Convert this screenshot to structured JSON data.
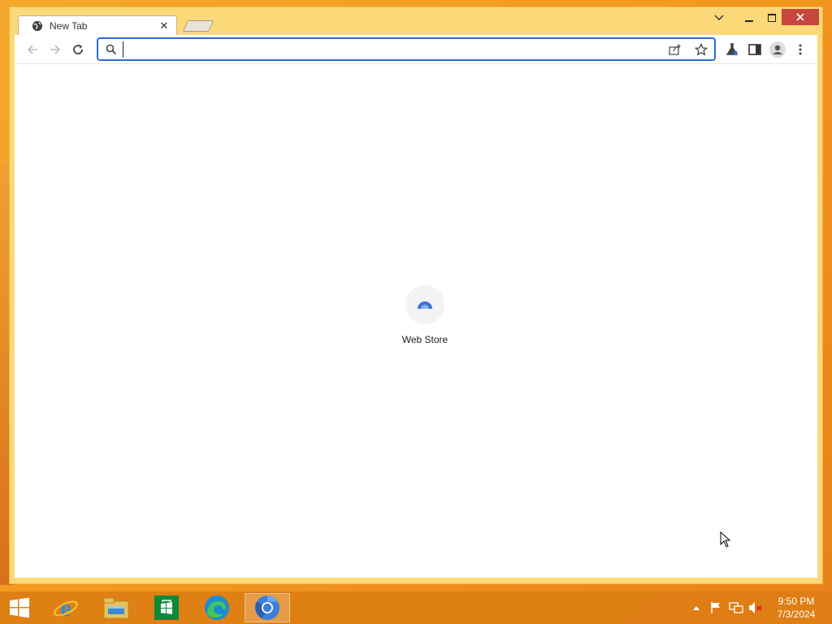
{
  "browser": {
    "tab": {
      "title": "New Tab",
      "close": "✕"
    },
    "window_controls": {
      "tab_search": "⌄",
      "minimize": "—",
      "maximize": "▢",
      "close": "✕"
    },
    "omnibox": {
      "value": "",
      "placeholder": ""
    }
  },
  "newtab_page": {
    "shortcuts": [
      {
        "label": "Web Store",
        "icon": "web-store-icon"
      }
    ]
  },
  "taskbar": {
    "items": [
      {
        "name": "start",
        "icon": "windows-logo-icon"
      },
      {
        "name": "internet-explorer",
        "icon": "internet-explorer-icon"
      },
      {
        "name": "file-explorer",
        "icon": "file-explorer-icon"
      },
      {
        "name": "store",
        "icon": "store-icon"
      },
      {
        "name": "edge",
        "icon": "edge-icon"
      },
      {
        "name": "chromium",
        "icon": "chromium-icon",
        "active": true
      }
    ],
    "clock": {
      "time": "9:50 PM",
      "date": "7/3/2024"
    }
  },
  "colors": {
    "accent": "#2f6bd0",
    "close": "#c7463d",
    "taskbar": "#dc7e14",
    "desktop": "#f39a1e"
  }
}
